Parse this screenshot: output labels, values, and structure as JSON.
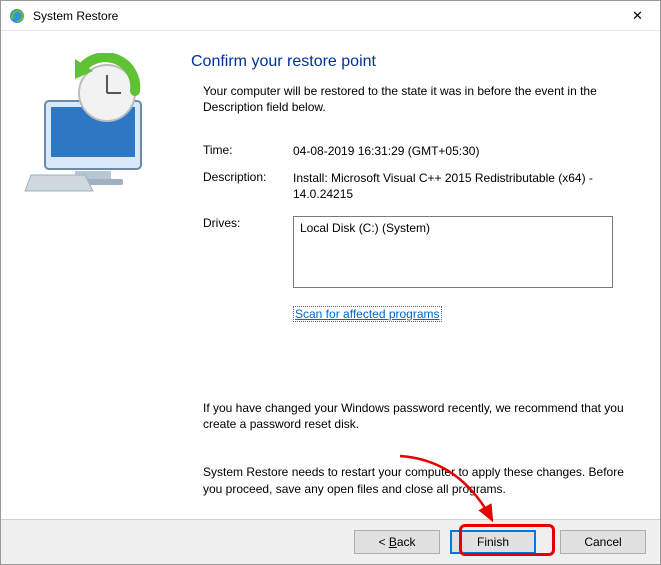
{
  "titlebar": {
    "title": "System Restore",
    "close_glyph": "✕"
  },
  "page": {
    "heading": "Confirm your restore point",
    "subtext": "Your computer will be restored to the state it was in before the event in the Description field below.",
    "time_label": "Time:",
    "time_value": "04-08-2019 16:31:29 (GMT+05:30)",
    "desc_label": "Description:",
    "desc_value": "Install: Microsoft Visual C++ 2015 Redistributable (x64) - 14.0.24215",
    "drives_label": "Drives:",
    "drives_value": "Local Disk (C:) (System)",
    "scan_link": "Scan for affected programs",
    "pw_warn": "If you have changed your Windows password recently, we recommend that you create a password reset disk.",
    "restart_warn": "System Restore needs to restart your computer to apply these changes. Before you proceed, save any open files and close all programs."
  },
  "footer": {
    "back_prefix": "< ",
    "back_accel": "B",
    "back_rest": "ack",
    "finish": "Finish",
    "cancel": "Cancel"
  }
}
